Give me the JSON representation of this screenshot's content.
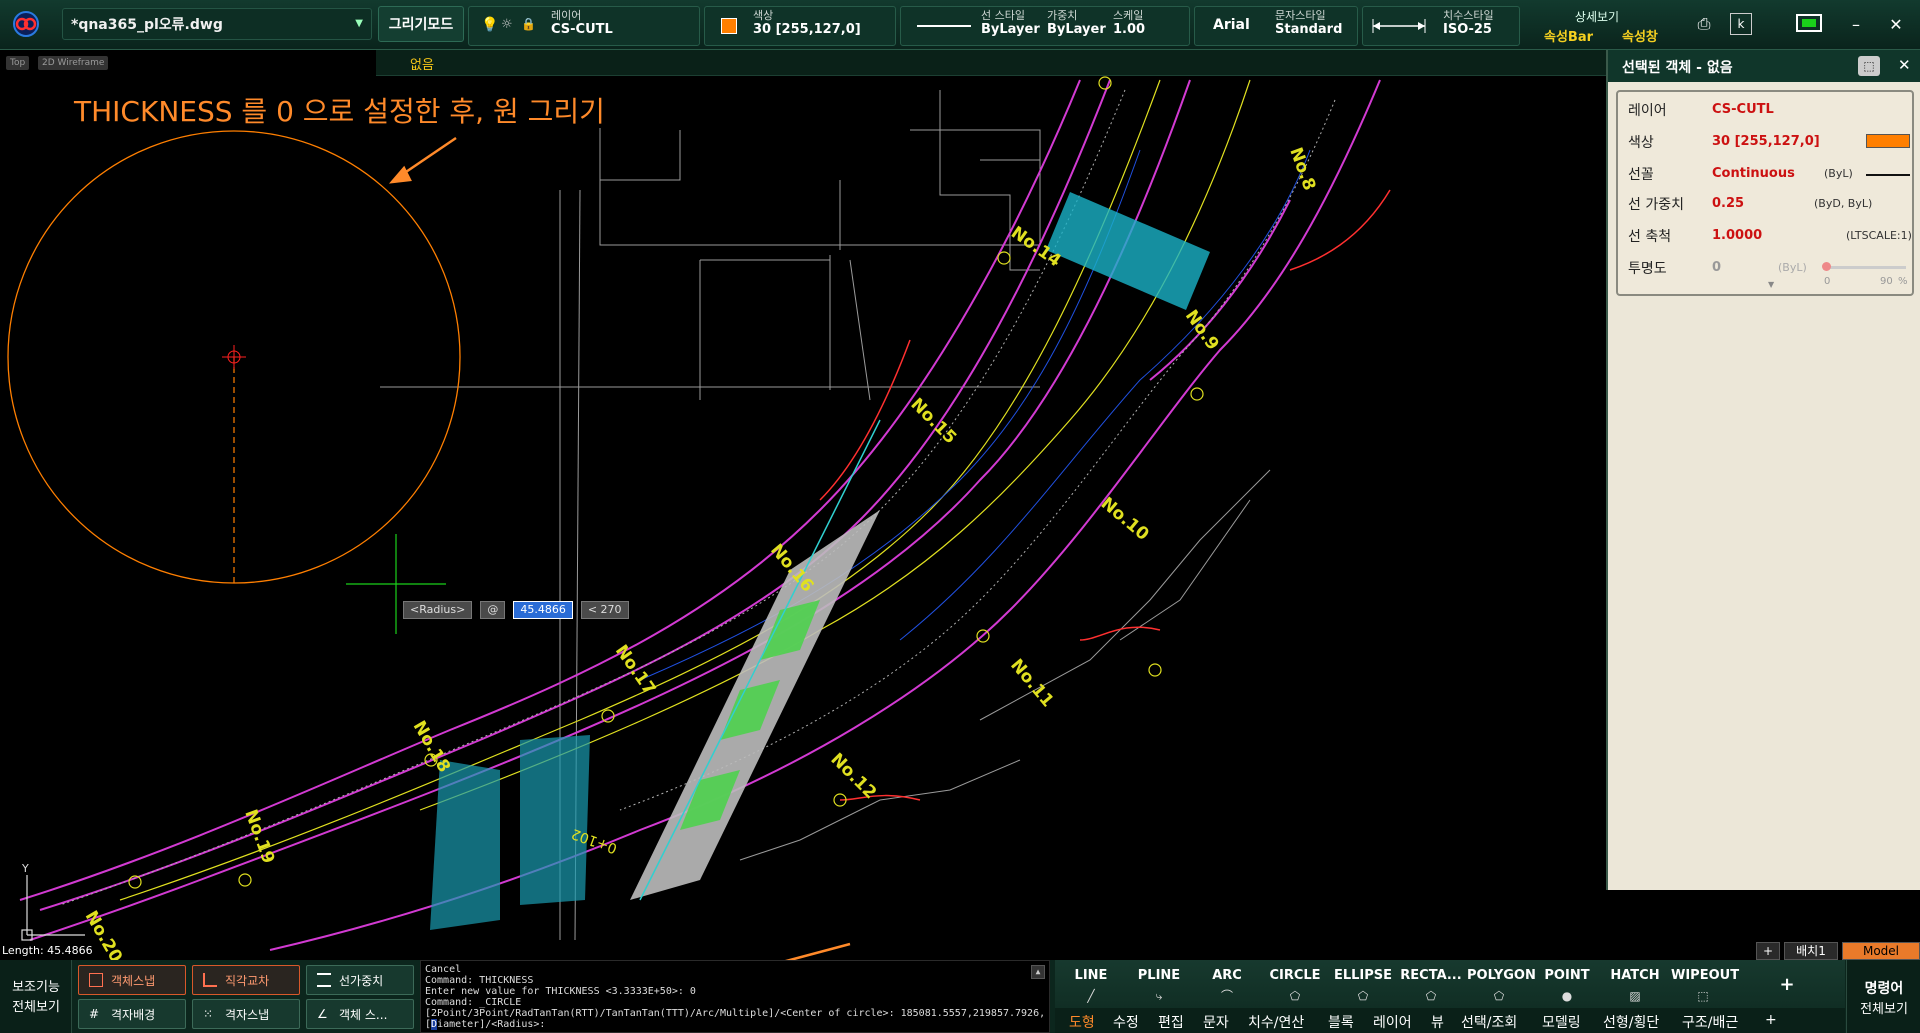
{
  "file": {
    "name": "*qna365_pl오류.dwg"
  },
  "top": {
    "mode_label": "그리기모드",
    "layer_label": "레이어",
    "layer_value": "CS-CUTL",
    "color_label": "색상",
    "color_value": "30 [255,127,0]",
    "linestyle_label": "선 스타일",
    "linestyle_value": "ByLayer",
    "weight_label": "가중치",
    "weight_value": "ByLayer",
    "scale_label": "스케일",
    "scale_value": "1.00",
    "font_value": "Arial",
    "textstyle_label": "문자스타일",
    "textstyle_value": "Standard",
    "dimstyle_label": "치수스타일",
    "dimstyle_value": "ISO-25",
    "detail_label": "상세보기",
    "propbar_label": "속성Bar",
    "propwin_label": "속성창",
    "color_hex": "#ff7f00"
  },
  "layerbar": {
    "value": "없음"
  },
  "view_tags": [
    "Top",
    "2D Wireframe"
  ],
  "annotation": "THICKNESS 를 0 으로 설정한 후, 원 그리기",
  "radius_tip": {
    "label": "<Radius>",
    "at": "@",
    "value": "45.4866",
    "angle": "< 270"
  },
  "drawing_labels": [
    "No.8",
    "No.9",
    "No.10",
    "No.11",
    "No.12",
    "No.14",
    "No.15",
    "No.16",
    "No.17",
    "No.18",
    "No.19",
    "No.20",
    "0+102"
  ],
  "panel": {
    "title": "선택된 객체 - 없음",
    "rows": [
      {
        "key": "레이어",
        "value": "CS-CUTL",
        "extra": ""
      },
      {
        "key": "색상",
        "value": "30 [255,127,0]",
        "extra": ""
      },
      {
        "key": "선꼴",
        "value": "Continuous",
        "extra": "(ByL)"
      },
      {
        "key": "선 가중치",
        "value": "0.25",
        "extra": "(ByD, ByL)"
      },
      {
        "key": "선 축척",
        "value": "1.0000",
        "extra": "(LTSCALE:1)"
      },
      {
        "key": "투명도",
        "value": "0",
        "extra": "(ByL)"
      }
    ],
    "transparency_min": "0",
    "transparency_max": "90",
    "transparency_unit": "%"
  },
  "status": {
    "length": "Length: 45.4866"
  },
  "aux": {
    "title": "보조기능",
    "sub": "전체보기"
  },
  "snaps": [
    {
      "label": "객체스냅",
      "on": true
    },
    {
      "label": "직각교차",
      "on": true
    },
    {
      "label": "선가중치",
      "on": false
    },
    {
      "label": "격자배경",
      "on": false
    },
    {
      "label": "격자스냅",
      "on": false
    },
    {
      "label": "객체 스...",
      "on": false
    }
  ],
  "cmd": {
    "lines": [
      "Cancel",
      "Command: THICKNESS",
      "Enter new value for THICKNESS <3.3333E+50>: 0",
      "Command: _CIRCLE",
      "[2Point/3Point/RadTanTan(RTT)/TanTanTan(TTT)/Arc/Multiple]/<Center of circle>: 185081.5557,219857.7926,0"
    ],
    "input_hl": "D",
    "input_rest": "iameter]/<Radius>:",
    "input_prefix": "["
  },
  "tools": [
    {
      "label": "LINE",
      "icon": "line-icon"
    },
    {
      "label": "PLINE",
      "icon": "pline-icon"
    },
    {
      "label": "ARC",
      "icon": "arc-icon"
    },
    {
      "label": "CIRCLE",
      "icon": "circle-icon"
    },
    {
      "label": "ELLIPSE",
      "icon": "ellipse-icon"
    },
    {
      "label": "RECTA...",
      "icon": "rectangle-icon"
    },
    {
      "label": "POLYGON",
      "icon": "polygon-icon"
    },
    {
      "label": "POINT",
      "icon": "point-icon"
    },
    {
      "label": "HATCH",
      "icon": "hatch-icon"
    },
    {
      "label": "WIPEOUT",
      "icon": "wipeout-icon"
    },
    {
      "label": "+",
      "icon": "plus-icon"
    }
  ],
  "tabs": [
    "도형",
    "수정",
    "편집",
    "문자",
    "치수/연산",
    "블록",
    "레이어",
    "뷰",
    "선택/조회",
    "모델링",
    "선형/횡단",
    "구조/배근",
    "+"
  ],
  "cmd_right": {
    "title": "명령어",
    "sub": "전체보기"
  },
  "layout_tabs": [
    "+",
    "배치1",
    "Model"
  ]
}
